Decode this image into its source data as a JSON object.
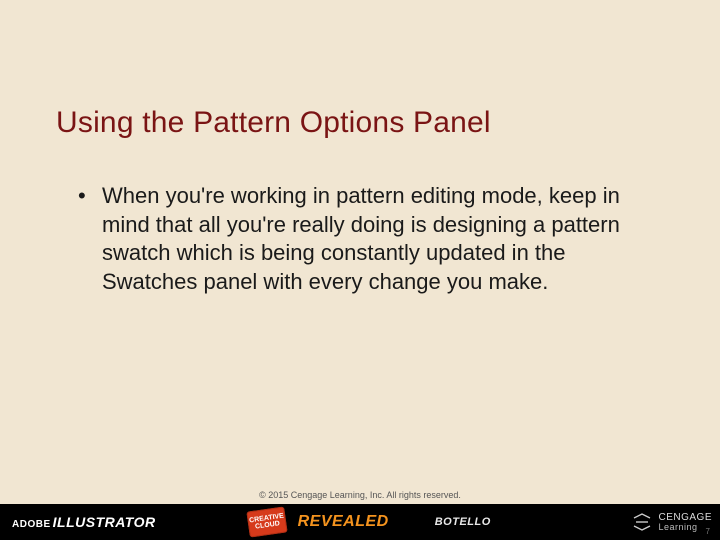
{
  "title": "Using the Pattern Options Panel",
  "bullets": [
    "When you're working in pattern editing mode, keep in mind that all you're really doing is designing a pattern swatch which is being constantly updated in the Swatches panel with every change you make."
  ],
  "footer": {
    "copyright": "© 2015 Cengage Learning, Inc. All rights reserved.",
    "adobe_small": "ADOBE",
    "adobe_big": "ILLUSTRATOR",
    "cc_line1": "CREATIVE",
    "cc_line2": "CLOUD",
    "revealed": "REVEALED",
    "author": "BOTELLO",
    "cengage_top": "CENGAGE",
    "cengage_bottom": "Learning",
    "page": "7"
  }
}
